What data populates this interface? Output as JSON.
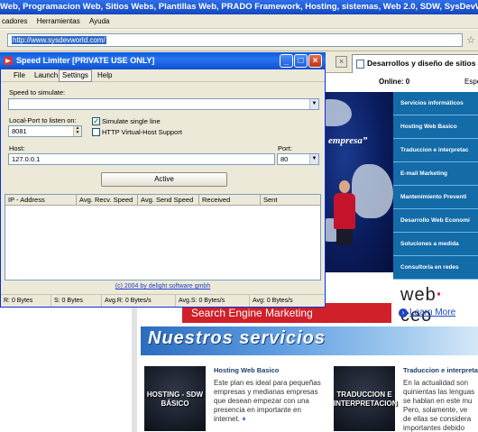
{
  "browser": {
    "title": "Web, Programacion Web, Sitios Webs, Plantillas Web, PRADO Framework, Hosting, sistemas, Web 2.0, SDW, SysDevWorld",
    "menu": [
      "cadores",
      "Herramientas",
      "Ayuda"
    ],
    "address": "http://www.sysdevworld.com/",
    "tab_title": "Desarrollos y diseño de sitios W"
  },
  "page": {
    "online_label": "Online: 0",
    "esp_label": "Espe",
    "hero_text": "empresa”",
    "services": [
      "Servicios informáticos",
      "Hosting Web Basico",
      "Traduccion e interpretac",
      "E-mail Marketing",
      "Mantenimiento Preventi",
      "Desarrollo Web Economi",
      "Soluciones a medida",
      "Consultoria en redes"
    ],
    "ad": {
      "headline": "Search Engine Marketing",
      "logo_a": "web",
      "logo_b": " ceo",
      "learn_more": "Learn More"
    },
    "nuestros": "Nuestros servicios",
    "cards": [
      {
        "image_text": "HOSTING - SDW BÁSICO",
        "title": "Hosting Web Basico",
        "body": "Este plan es ideal para pequeñas empresas y medianas empresas que desean empezar con una presencia en importante en internet.",
        "more": "+"
      },
      {
        "image_text": "TRADUCCION E INTERPRETACION",
        "title": "Traduccion e interpretac",
        "lines": [
          "En la actualidad son",
          "quinientas las lenguas",
          "se hablan en este mu",
          "Pero, solamente, ve",
          "de ellas se considera",
          "importantes debido"
        ]
      }
    ]
  },
  "speed_limiter": {
    "title": "Speed Limiter [PRIVATE USE ONLY]",
    "menu": {
      "file": "File",
      "launch": "Launch",
      "settings": "Settings",
      "help": "Help"
    },
    "speed_label": "Speed to simulate:",
    "speed_value": "",
    "local_port_label": "Local-Port to listen on:",
    "local_port_value": "8081",
    "simulate_single_line": "Simulate single line",
    "simulate_single_line_checked": true,
    "http_virtual_host": "HTTP Virtual-Host Support",
    "http_virtual_host_checked": false,
    "host_label": "Host:",
    "host_value": "127.0.0.1",
    "port_label": "Port:",
    "port_value": "80",
    "active_button": "Active",
    "columns": [
      "IP - Address",
      "Avg. Recv. Speed",
      "Avg. Send Speed",
      "Received",
      "Sent"
    ],
    "copyright": "(c) 2004 by delight software gmbh",
    "status": [
      "R: 0 Bytes",
      "S: 0 Bytes",
      "Avg.R: 0 Bytes/s",
      "Avg.S: 0 Bytes/s",
      "Avg: 0 Bytes/s"
    ]
  }
}
